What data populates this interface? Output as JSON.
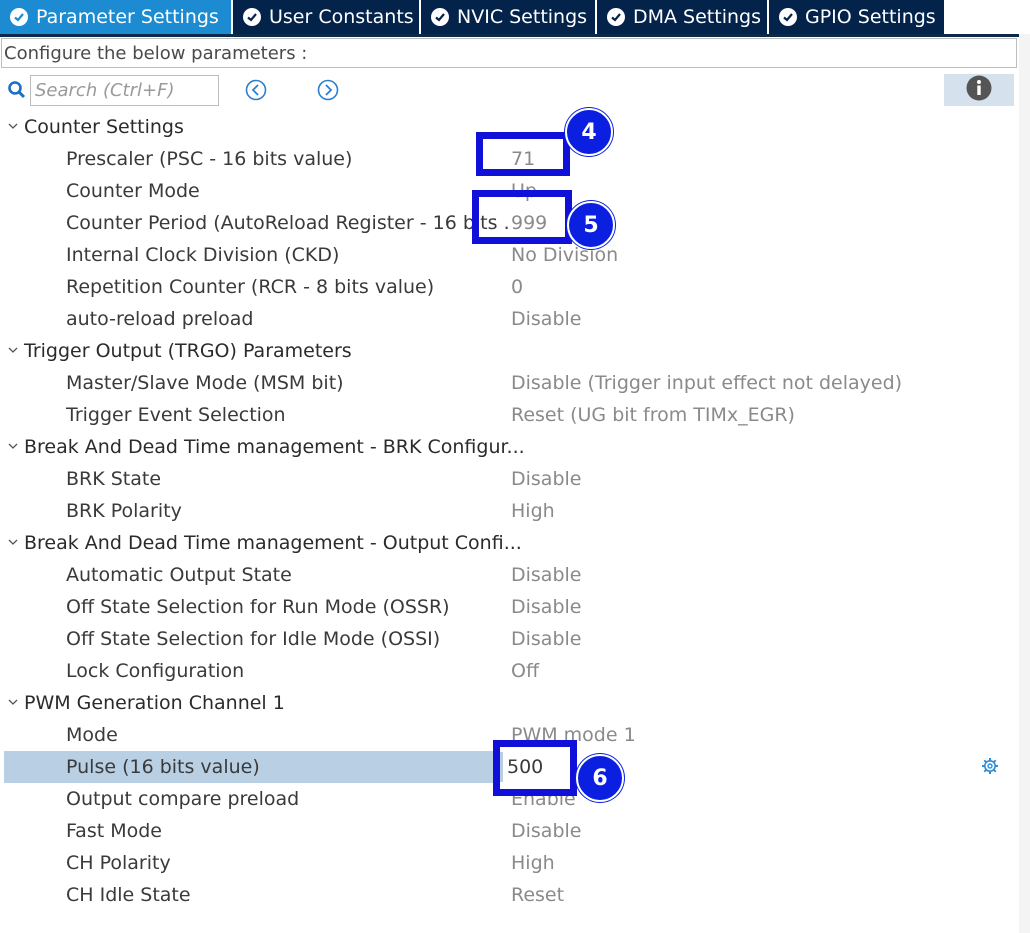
{
  "tabs": [
    {
      "label": "Parameter Settings",
      "active": true
    },
    {
      "label": "User Constants",
      "active": false
    },
    {
      "label": "NVIC Settings",
      "active": false
    },
    {
      "label": "DMA Settings",
      "active": false
    },
    {
      "label": "GPIO Settings",
      "active": false
    }
  ],
  "configure_text": "Configure the below parameters :",
  "search": {
    "placeholder": "Search (Ctrl+F)"
  },
  "groups": [
    {
      "title": "Counter Settings"
    },
    {
      "title": "Trigger Output (TRGO) Parameters"
    },
    {
      "title": "Break And Dead Time management - BRK Configur..."
    },
    {
      "title": "Break And Dead Time management - Output Confi..."
    },
    {
      "title": "PWM Generation Channel 1"
    }
  ],
  "params": [
    {
      "label": "Prescaler (PSC - 16 bits value)",
      "value": "71"
    },
    {
      "label": "Counter Mode",
      "value": "Up"
    },
    {
      "label": "Counter Period (AutoReload Register - 16 bits ...",
      "value": "999"
    },
    {
      "label": "Internal Clock Division (CKD)",
      "value": "No Division"
    },
    {
      "label": "Repetition Counter (RCR - 8 bits value)",
      "value": "0"
    },
    {
      "label": "auto-reload preload",
      "value": "Disable"
    },
    {
      "label": "Master/Slave Mode (MSM bit)",
      "value": "Disable (Trigger input effect not delayed)"
    },
    {
      "label": "Trigger Event Selection",
      "value": "Reset (UG bit from TIMx_EGR)"
    },
    {
      "label": "BRK State",
      "value": "Disable"
    },
    {
      "label": "BRK Polarity",
      "value": "High"
    },
    {
      "label": "Automatic Output State",
      "value": "Disable"
    },
    {
      "label": "Off State Selection for Run Mode (OSSR)",
      "value": "Disable"
    },
    {
      "label": "Off State Selection for Idle Mode (OSSI)",
      "value": "Disable"
    },
    {
      "label": "Lock Configuration",
      "value": "Off"
    },
    {
      "label": "Mode",
      "value": "PWM mode 1"
    },
    {
      "label": "Pulse (16 bits value)",
      "value": "500"
    },
    {
      "label": "Output compare preload",
      "value": "Enable"
    },
    {
      "label": "Fast Mode",
      "value": "Disable"
    },
    {
      "label": "CH Polarity",
      "value": "High"
    },
    {
      "label": "CH Idle State",
      "value": "Reset"
    }
  ],
  "annotations": {
    "a4": "4",
    "a5": "5",
    "a6": "6"
  },
  "colors": {
    "active_tab": "#1c8bd1",
    "tab_bg": "#03234b",
    "highlight": "#1010d8",
    "selected_row": "#b9cfe4"
  }
}
